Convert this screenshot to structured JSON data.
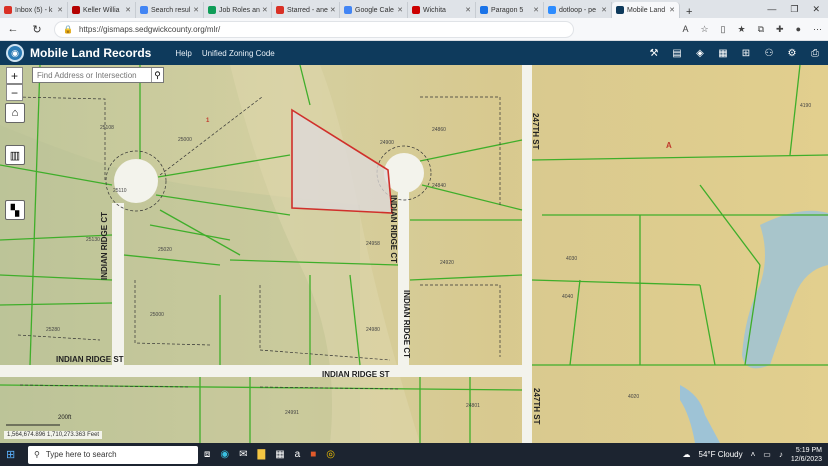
{
  "browser": {
    "tabs": [
      {
        "label": "Inbox (5) - k",
        "color": "#d93025"
      },
      {
        "label": "Keller Willia",
        "color": "#b40101"
      },
      {
        "label": "Search resul",
        "color": "#4285f4"
      },
      {
        "label": "Job Roles an",
        "color": "#0f9d58"
      },
      {
        "label": "Starred - ane",
        "color": "#d93025"
      },
      {
        "label": "Google Cale",
        "color": "#4285f4"
      },
      {
        "label": "Wichita",
        "color": "#c00"
      },
      {
        "label": "Paragon 5",
        "color": "#1a73e8"
      },
      {
        "label": "dotloop - pe",
        "color": "#2d8cff"
      },
      {
        "label": "Mobile Land",
        "color": "#0e3a5c"
      }
    ],
    "new_tab": "+",
    "url": "https://gismaps.sedgwickcounty.org/mlr/"
  },
  "app": {
    "title": "Mobile Land Records",
    "links": [
      "Help",
      "Unified Zoning Code"
    ]
  },
  "map": {
    "search_placeholder": "Find Address or Intersection",
    "zoom_in": "+",
    "zoom_out": "−",
    "scale_label": "200ft",
    "coordinates": "1,564,674.896 1,710,273.363 Feet",
    "streets": {
      "indian_ridge_ct_west": "INDIAN RIDGE CT",
      "indian_ridge_ct_center": "INDIAN RIDGE CT",
      "indian_ridge_ct_lower": "INDIAN RIDGE CT",
      "indian_ridge_st_west": "INDIAN RIDGE ST",
      "indian_ridge_st_center": "INDIAN RIDGE ST",
      "n247_top": "247TH ST",
      "n247_bottom": "247TH ST"
    },
    "parcels": [
      "25108",
      "25000",
      "24900",
      "24860",
      "24840",
      "25110",
      "25130",
      "25020",
      "24958",
      "24920",
      "25280",
      "25000",
      "24980",
      "24991",
      "24801",
      "4190",
      "4030",
      "4040",
      "4020"
    ],
    "zone_labels": [
      "A",
      "1"
    ]
  },
  "taskbar": {
    "search_placeholder": "Type here to search",
    "weather": "54°F  Cloudy",
    "time": "5:19 PM",
    "date": "12/6/2023"
  }
}
